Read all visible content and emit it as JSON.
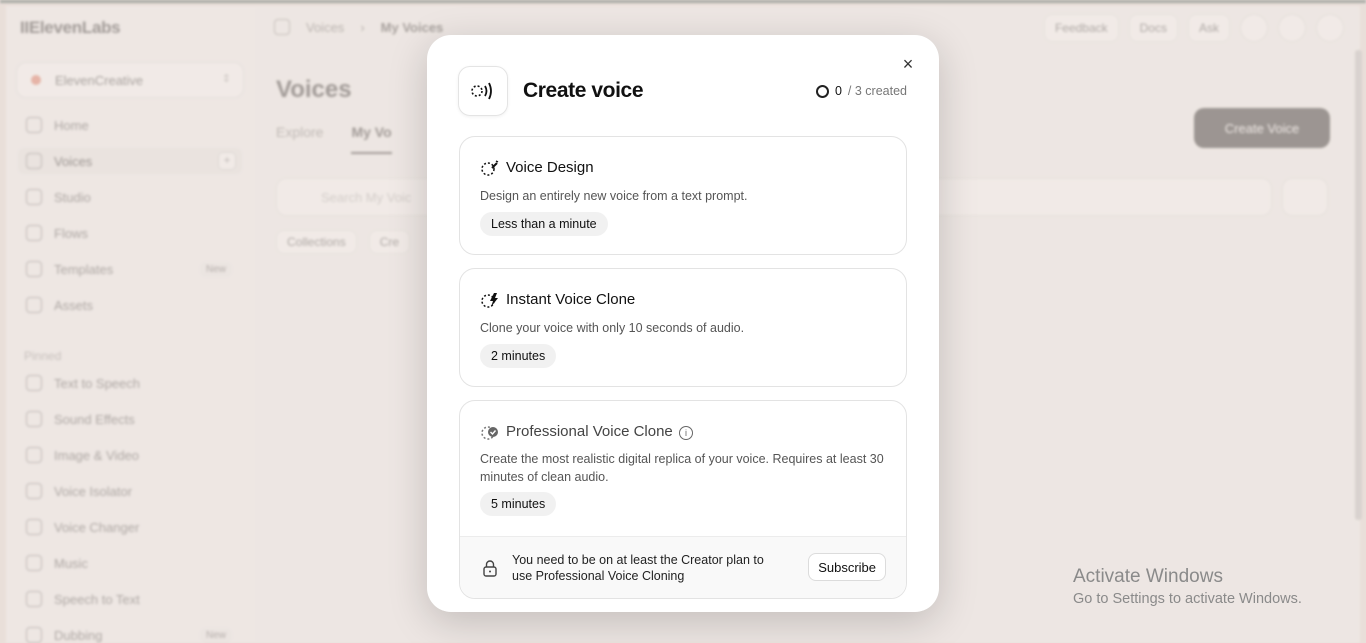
{
  "app": {
    "logo": "IIElevenLabs",
    "workspace": "ElevenCreative",
    "nav": [
      {
        "label": "Home"
      },
      {
        "label": "Voices"
      },
      {
        "label": "Studio"
      },
      {
        "label": "Flows"
      },
      {
        "label": "Templates",
        "badge": "New"
      },
      {
        "label": "Assets"
      }
    ],
    "pinned_label": "Pinned",
    "pinned": [
      {
        "label": "Text to Speech"
      },
      {
        "label": "Sound Effects"
      },
      {
        "label": "Image & Video"
      },
      {
        "label": "Voice Isolator"
      },
      {
        "label": "Voice Changer"
      },
      {
        "label": "Music"
      },
      {
        "label": "Speech to Text"
      },
      {
        "label": "Dubbing",
        "badge": "New"
      }
    ],
    "breadcrumb": [
      "Voices",
      "My Voices"
    ],
    "top_buttons": [
      "Feedback",
      "Docs",
      "Ask"
    ],
    "page_title": "Voices",
    "tabs": [
      "Explore",
      "My Vo"
    ],
    "search_placeholder": "Search My Voic",
    "filters": [
      "Collections",
      "Cre"
    ],
    "create_button": "Create Voice"
  },
  "modal": {
    "title": "Create voice",
    "counter": {
      "used": "0",
      "rest": "/ 3 created"
    },
    "close": "×",
    "cards": [
      {
        "title": "Voice Design",
        "description": "Design an entirely new voice from a text prompt.",
        "duration": "Less than a minute"
      },
      {
        "title": "Instant Voice Clone",
        "description": "Clone your voice with only 10 seconds of audio.",
        "duration": "2 minutes"
      },
      {
        "title": "Professional Voice Clone",
        "description": "Create the most realistic digital replica of your voice. Requires at least 30 minutes of clean audio.",
        "duration": "5 minutes",
        "lock_message": "You need to be on at least the Creator plan to use Professional Voice Cloning",
        "subscribe": "Subscribe"
      }
    ]
  },
  "watermark": {
    "line1": "Activate Windows",
    "line2": "Go to Settings to activate Windows."
  }
}
